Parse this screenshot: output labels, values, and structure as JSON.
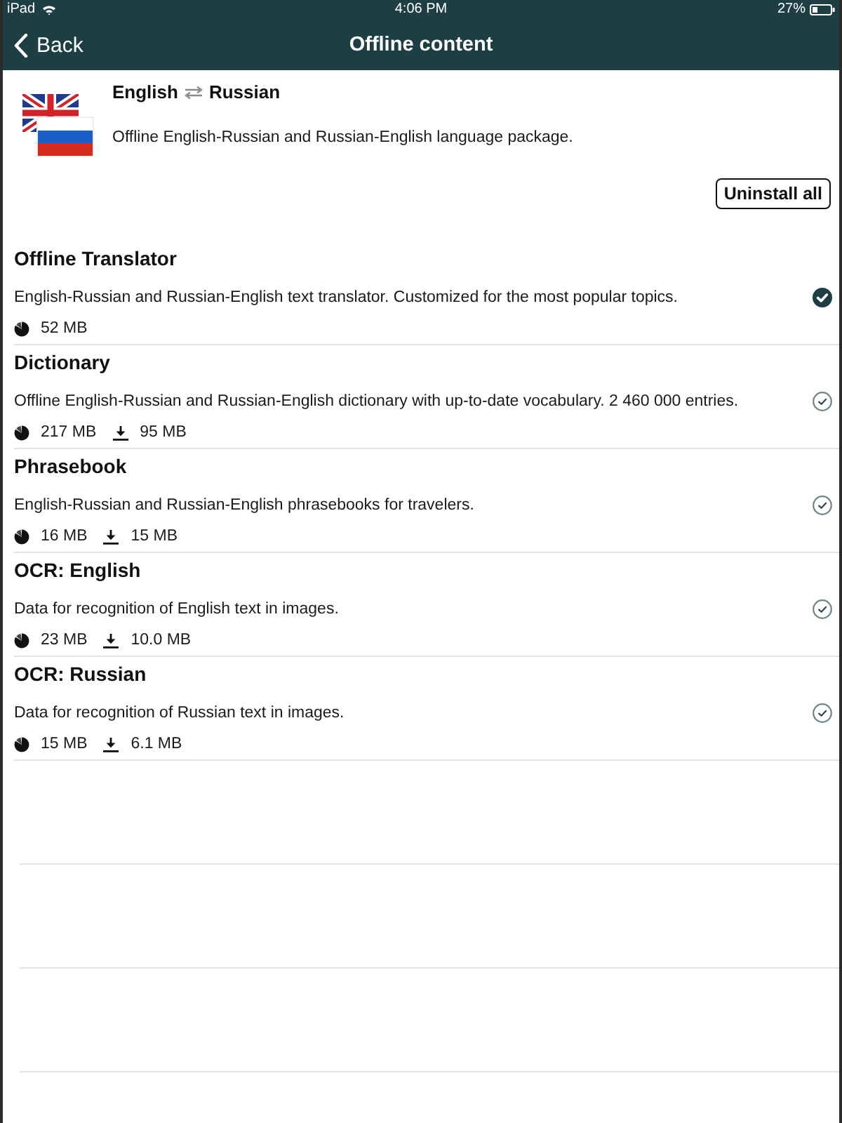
{
  "status_bar": {
    "device": "iPad",
    "time": "4:06 PM",
    "battery": "27%"
  },
  "nav_bar": {
    "back": "Back",
    "title": "Offline content"
  },
  "package": {
    "source_language": "English",
    "target_language": "Russian",
    "description": "Offline English-Russian and Russian-English language package.",
    "action": "Uninstall all"
  },
  "sections": [
    {
      "title": "Offline Translator",
      "description": "English-Russian and Russian-English text translator. Customized for the most popular topics.",
      "installed": true,
      "sizes": [
        {
          "kind": "disk",
          "text": "52 MB"
        }
      ]
    },
    {
      "title": "Dictionary",
      "description": "Offline English-Russian and Russian-English dictionary with up-to-date vocabulary. 2 460 000 entries.",
      "installed": false,
      "sizes": [
        {
          "kind": "disk",
          "text": "217 MB"
        },
        {
          "kind": "download",
          "text": "95 MB"
        }
      ]
    },
    {
      "title": "Phrasebook",
      "description": "English-Russian and Russian-English phrasebooks for travelers.",
      "installed": false,
      "sizes": [
        {
          "kind": "disk",
          "text": "16 MB"
        },
        {
          "kind": "download",
          "text": "15 MB"
        }
      ]
    },
    {
      "title": "OCR: English",
      "description": "Data for recognition of English text in images.",
      "installed": false,
      "sizes": [
        {
          "kind": "disk",
          "text": "23 MB"
        },
        {
          "kind": "download",
          "text": "10.0 MB"
        }
      ]
    },
    {
      "title": "OCR: Russian",
      "description": "Data for recognition of Russian text in images.",
      "installed": false,
      "sizes": [
        {
          "kind": "disk",
          "text": "15 MB"
        },
        {
          "kind": "download",
          "text": "6.1 MB"
        }
      ]
    }
  ]
}
